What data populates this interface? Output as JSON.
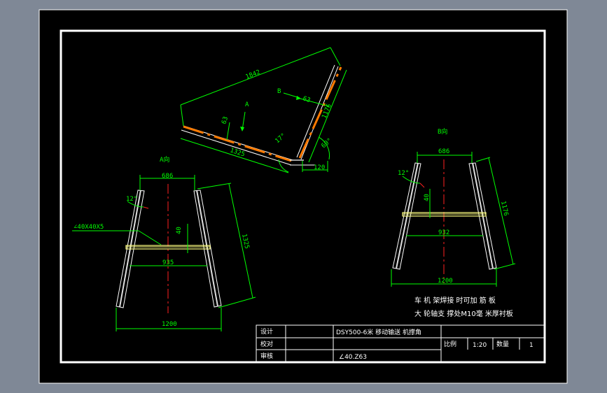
{
  "colors": {
    "background": "#7f8896",
    "sheet": "#000000",
    "border": "#ffffff",
    "dimension": "#00ff00",
    "centerline": "#ff2020",
    "steel": "#ffffff",
    "highlight_orange": "#ff7a00",
    "brace": "#ffff80",
    "grip": "#e0e0e0"
  },
  "main_view": {
    "dims": {
      "span": "1842",
      "lower_leg": "1325",
      "upper_leg": "1176",
      "offset_a": "63",
      "offset_b": "63",
      "angle_inner": "17°",
      "angle_outer": "69°",
      "foot": "120"
    },
    "arrows": {
      "a": "A",
      "b": "B"
    }
  },
  "view_a": {
    "title": "A向",
    "dims": {
      "top": "686",
      "height": "1325",
      "brace": "935",
      "bottom": "1200",
      "gap": "40",
      "angle": "12°"
    },
    "material": "∠40X40X5"
  },
  "view_b": {
    "title": "B向",
    "dims": {
      "top": "686",
      "height": "1176",
      "brace": "932",
      "bottom": "1200",
      "gap": "40",
      "angle": "12°"
    }
  },
  "notes": [
    "车 机 架焊接 时可加 筋 板",
    "大 轮轴支 撑处M10毫 米厚衬板"
  ],
  "title_block": {
    "row_labels": [
      "设计",
      "校对",
      "审核"
    ],
    "drawing_title": "DSY500-6米 移动输送 机撑角",
    "material": "∠40.Z63",
    "scale_label": "比例",
    "scale_value": "1:20",
    "qty_label": "数量",
    "qty_value": "1"
  }
}
